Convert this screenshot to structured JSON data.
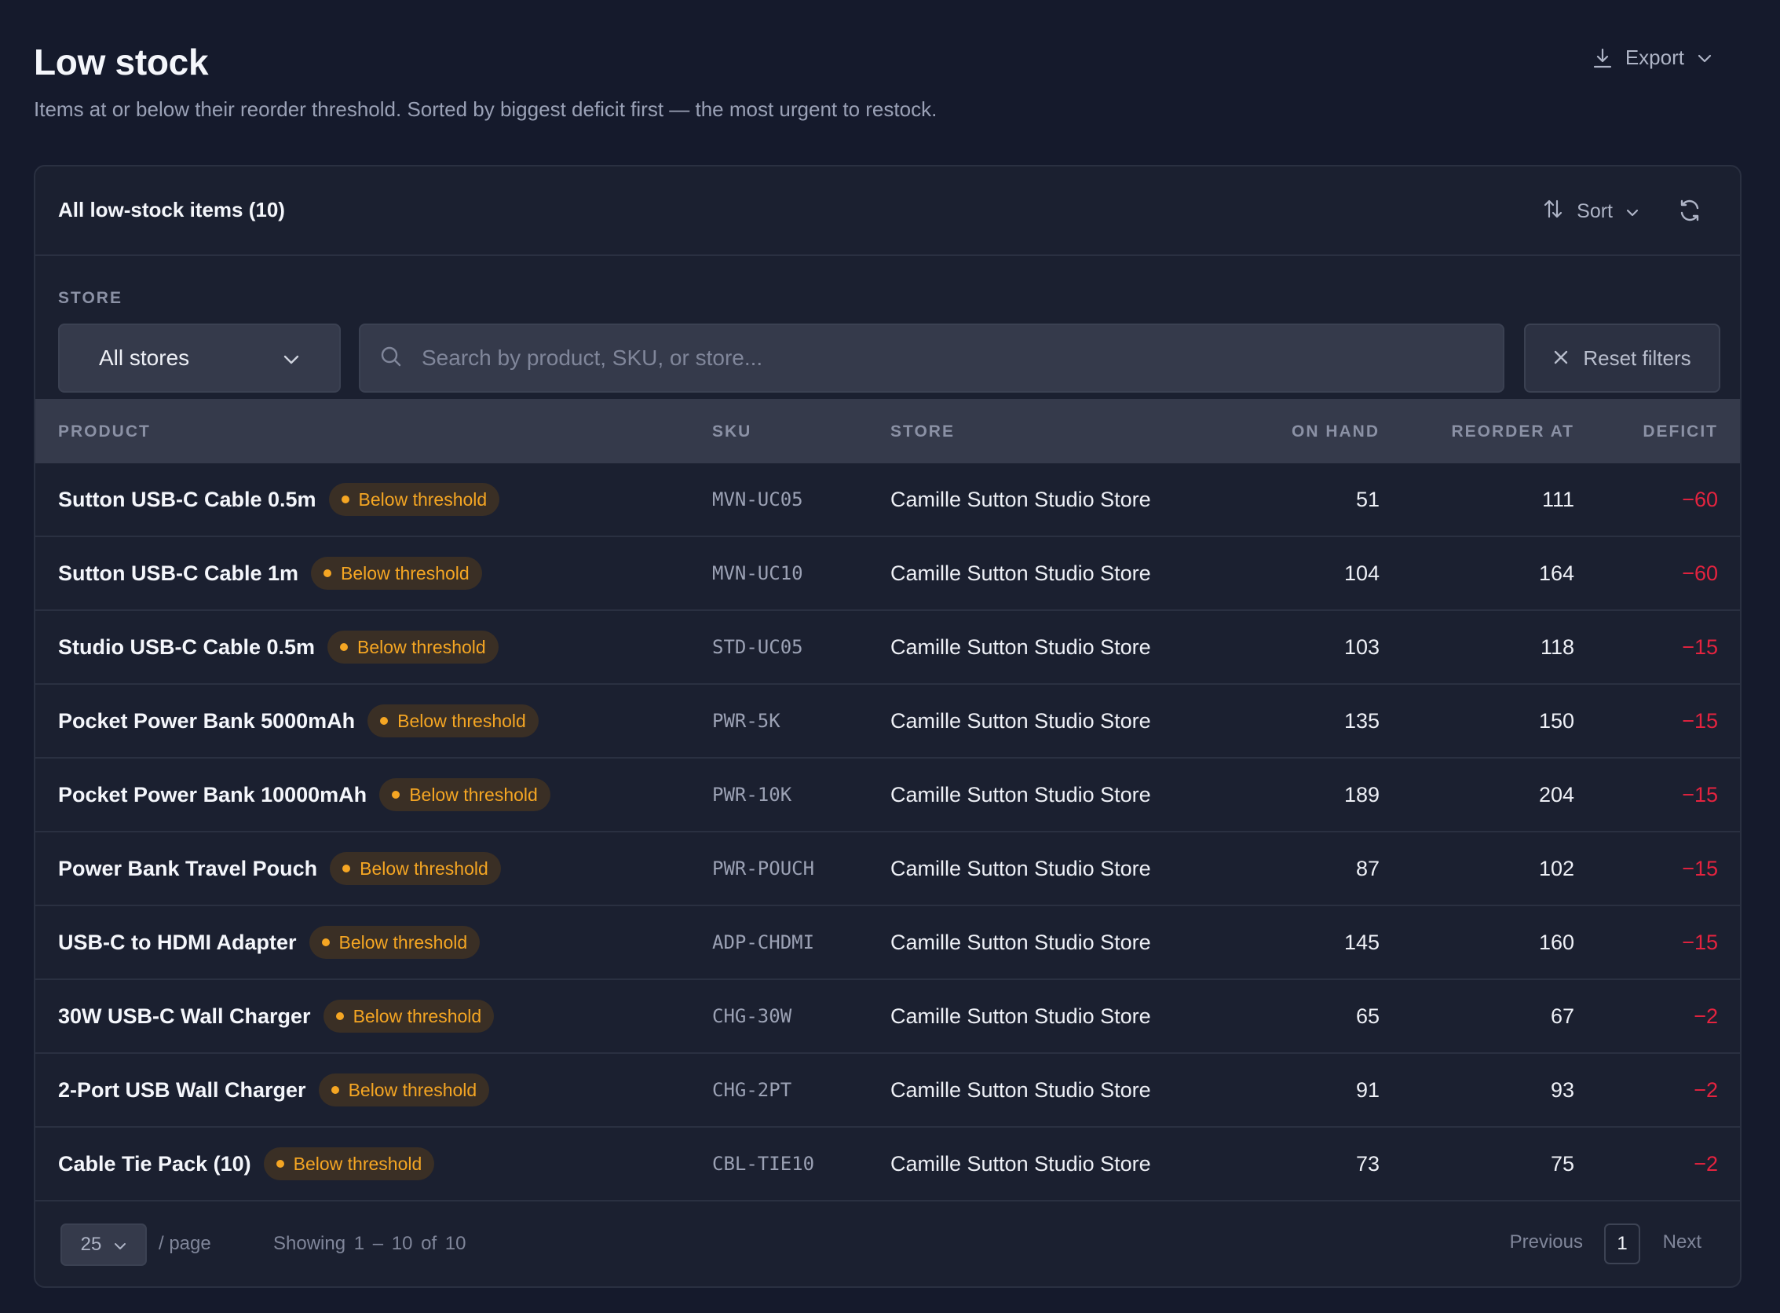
{
  "header": {
    "title": "Low stock",
    "subtitle": "Items at or below their reorder threshold. Sorted by biggest deficit first — the most urgent to restock.",
    "export_label": "Export"
  },
  "card": {
    "title": "All low-stock items (10)",
    "sort_label": "Sort"
  },
  "filters": {
    "store_label": "STORE",
    "store_selected": "All stores",
    "search_placeholder": "Search by product, SKU, or store...",
    "reset_label": "Reset filters"
  },
  "table": {
    "columns": {
      "product": "PRODUCT",
      "sku": "SKU",
      "store": "STORE",
      "on_hand": "ON HAND",
      "reorder_at": "REORDER AT",
      "deficit": "DEFICIT"
    },
    "rows": [
      {
        "product": "Sutton USB-C Cable 0.5m",
        "badge": "Below threshold",
        "sku": "MVN-UC05",
        "store": "Camille Sutton Studio Store",
        "on_hand": "51",
        "reorder_at": "111",
        "deficit": "−60"
      },
      {
        "product": "Sutton USB-C Cable 1m",
        "badge": "Below threshold",
        "sku": "MVN-UC10",
        "store": "Camille Sutton Studio Store",
        "on_hand": "104",
        "reorder_at": "164",
        "deficit": "−60"
      },
      {
        "product": "Studio USB-C Cable 0.5m",
        "badge": "Below threshold",
        "sku": "STD-UC05",
        "store": "Camille Sutton Studio Store",
        "on_hand": "103",
        "reorder_at": "118",
        "deficit": "−15"
      },
      {
        "product": "Pocket Power Bank 5000mAh",
        "badge": "Below threshold",
        "sku": "PWR-5K",
        "store": "Camille Sutton Studio Store",
        "on_hand": "135",
        "reorder_at": "150",
        "deficit": "−15"
      },
      {
        "product": "Pocket Power Bank 10000mAh",
        "badge": "Below threshold",
        "sku": "PWR-10K",
        "store": "Camille Sutton Studio Store",
        "on_hand": "189",
        "reorder_at": "204",
        "deficit": "−15"
      },
      {
        "product": "Power Bank Travel Pouch",
        "badge": "Below threshold",
        "sku": "PWR-POUCH",
        "store": "Camille Sutton Studio Store",
        "on_hand": "87",
        "reorder_at": "102",
        "deficit": "−15"
      },
      {
        "product": "USB-C to HDMI Adapter",
        "badge": "Below threshold",
        "sku": "ADP-CHDMI",
        "store": "Camille Sutton Studio Store",
        "on_hand": "145",
        "reorder_at": "160",
        "deficit": "−15"
      },
      {
        "product": "30W USB-C Wall Charger",
        "badge": "Below threshold",
        "sku": "CHG-30W",
        "store": "Camille Sutton Studio Store",
        "on_hand": "65",
        "reorder_at": "67",
        "deficit": "−2"
      },
      {
        "product": "2-Port USB Wall Charger",
        "badge": "Below threshold",
        "sku": "CHG-2PT",
        "store": "Camille Sutton Studio Store",
        "on_hand": "91",
        "reorder_at": "93",
        "deficit": "−2"
      },
      {
        "product": "Cable Tie Pack (10)",
        "badge": "Below threshold",
        "sku": "CBL-TIE10",
        "store": "Camille Sutton Studio Store",
        "on_hand": "73",
        "reorder_at": "75",
        "deficit": "−2"
      }
    ]
  },
  "footer": {
    "per_page_value": "25",
    "per_page_label": "/ page",
    "showing": "Showing 1 – 10 of 10",
    "previous_label": "Previous",
    "current_page": "1",
    "next_label": "Next"
  },
  "icons": {
    "export": "download-icon",
    "sort": "sort-arrows-icon",
    "refresh": "refresh-icon",
    "search": "search-icon",
    "reset": "close-icon",
    "dropdown": "chevron-down-icon",
    "badge": "status-dot-icon"
  },
  "colors": {
    "background": "#151a2c",
    "card": "#1b2030",
    "badge_text": "#f5a623",
    "badge_bg": "#3a2f25",
    "deficit": "#e5233f"
  }
}
